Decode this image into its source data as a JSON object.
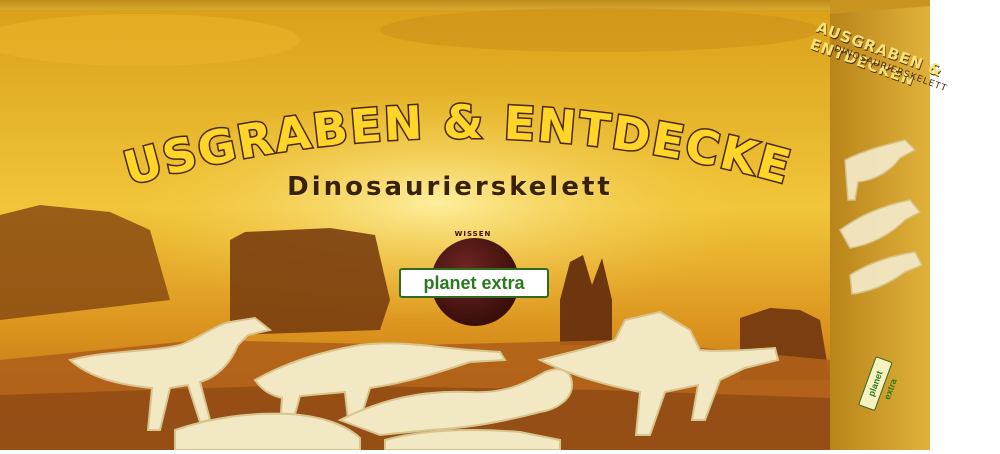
{
  "box": {
    "title": "AUSGRABEN & ENTDECKEN",
    "subtitle": "Dinosaurierskelett",
    "logo_top": "WISSEN",
    "logo_text": "planet extra",
    "side_title": "AUSGRABEN & ENTDECKEN",
    "side_subtitle": "DINOSAURIERSKELETT",
    "side_logo": "planet extra"
  },
  "colors": {
    "sky_gold": "#e8b51f",
    "desert_orange": "#c9781a",
    "title_fill": "#ffd52a",
    "title_outline": "#4a2906",
    "logo_maroon": "#3b0f0c",
    "logo_green": "#2b7a1e",
    "bone_cream": "#f3e8c4"
  }
}
